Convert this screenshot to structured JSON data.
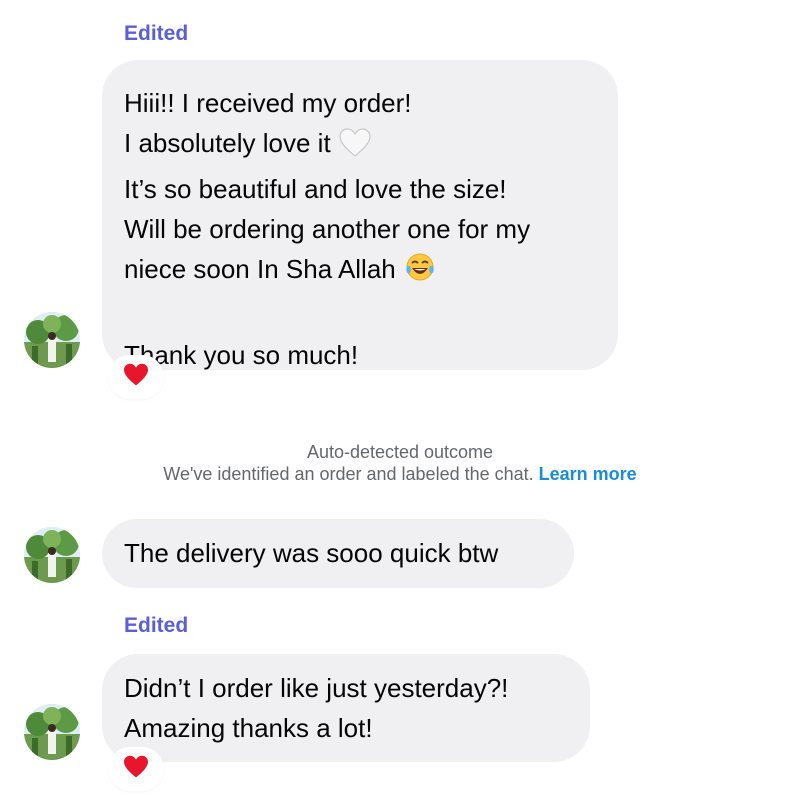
{
  "messages": [
    {
      "edited_label": "Edited",
      "lines": [
        "Hiii!! I received my order!",
        "I absolutely love it",
        "It’s so beautiful and love the size!",
        "Will be ordering another one for my",
        "niece soon In Sha Allah",
        "",
        "Thank you so much!"
      ],
      "emojis": [
        "white-heart-icon",
        "tears-of-joy-icon"
      ],
      "reaction": "red-heart-icon"
    },
    {
      "lines": [
        "The delivery was sooo quick btw"
      ]
    },
    {
      "edited_label": "Edited",
      "lines": [
        "Didn’t I order like just yesterday?!",
        "Amazing thanks a lot!"
      ],
      "reaction": "red-heart-icon"
    }
  ],
  "system_notice": {
    "title": "Auto-detected outcome",
    "text": "We've identified an order and labeled the chat.",
    "link": "Learn more"
  },
  "colors": {
    "bubble": "#f0f0f2",
    "edited": "#5b5fd6",
    "link": "#1a8cd8",
    "system_text": "#65676b"
  }
}
